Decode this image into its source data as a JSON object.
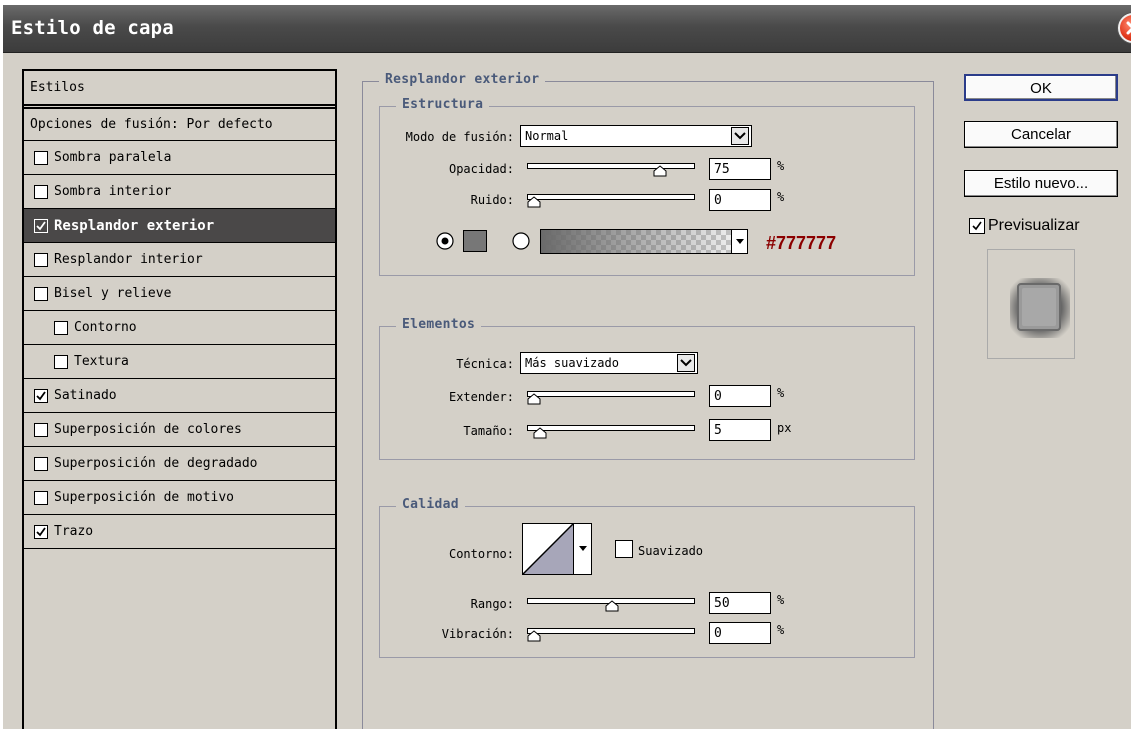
{
  "window": {
    "title": "Estilo de capa"
  },
  "styles": {
    "header": "Estilos",
    "blending_options": "Opciones de fusión: Por defecto",
    "items": [
      {
        "label": "Sombra paralela",
        "checked": false,
        "indent": false,
        "active": false
      },
      {
        "label": "Sombra interior",
        "checked": false,
        "indent": false,
        "active": false
      },
      {
        "label": "Resplandor exterior",
        "checked": true,
        "indent": false,
        "active": true
      },
      {
        "label": "Resplandor interior",
        "checked": false,
        "indent": false,
        "active": false
      },
      {
        "label": "Bisel y relieve",
        "checked": false,
        "indent": false,
        "active": false
      },
      {
        "label": "Contorno",
        "checked": false,
        "indent": true,
        "active": false
      },
      {
        "label": "Textura",
        "checked": false,
        "indent": true,
        "active": false
      },
      {
        "label": "Satinado",
        "checked": true,
        "indent": false,
        "active": false
      },
      {
        "label": "Superposición de colores",
        "checked": false,
        "indent": false,
        "active": false
      },
      {
        "label": "Superposición de degradado",
        "checked": false,
        "indent": false,
        "active": false
      },
      {
        "label": "Superposición de motivo",
        "checked": false,
        "indent": false,
        "active": false
      },
      {
        "label": "Trazo",
        "checked": true,
        "indent": false,
        "active": false
      }
    ]
  },
  "panel": {
    "title": "Resplandor exterior",
    "structure": {
      "legend": "Estructura",
      "blend_mode_label": "Modo de fusión:",
      "blend_mode_value": "Normal",
      "opacity_label": "Opacidad:",
      "opacity_value": "75",
      "opacity_unit": "%",
      "noise_label": "Ruido:",
      "noise_value": "0",
      "noise_unit": "%",
      "color_hex": "#777777",
      "swatch_color": "#777777",
      "selected_fill": "color"
    },
    "elements": {
      "legend": "Elementos",
      "technique_label": "Técnica:",
      "technique_value": "Más suavizado",
      "spread_label": "Extender:",
      "spread_value": "0",
      "spread_unit": "%",
      "size_label": "Tamaño:",
      "size_value": "5",
      "size_unit": "px"
    },
    "quality": {
      "legend": "Calidad",
      "contour_label": "Contorno:",
      "antialiased_label": "Suavizado",
      "antialiased_checked": false,
      "range_label": "Rango:",
      "range_value": "50",
      "range_unit": "%",
      "jitter_label": "Vibración:",
      "jitter_value": "0",
      "jitter_unit": "%"
    }
  },
  "buttons": {
    "ok": "OK",
    "cancel": "Cancelar",
    "new_style": "Estilo nuevo...",
    "preview_label": "Previsualizar",
    "preview_checked": true
  },
  "colors": {
    "accent_text": "#8b0000",
    "legend_text": "#4a5a7a",
    "dialog_bg": "#d4d0c8",
    "active_row_bg": "#4a4848"
  }
}
